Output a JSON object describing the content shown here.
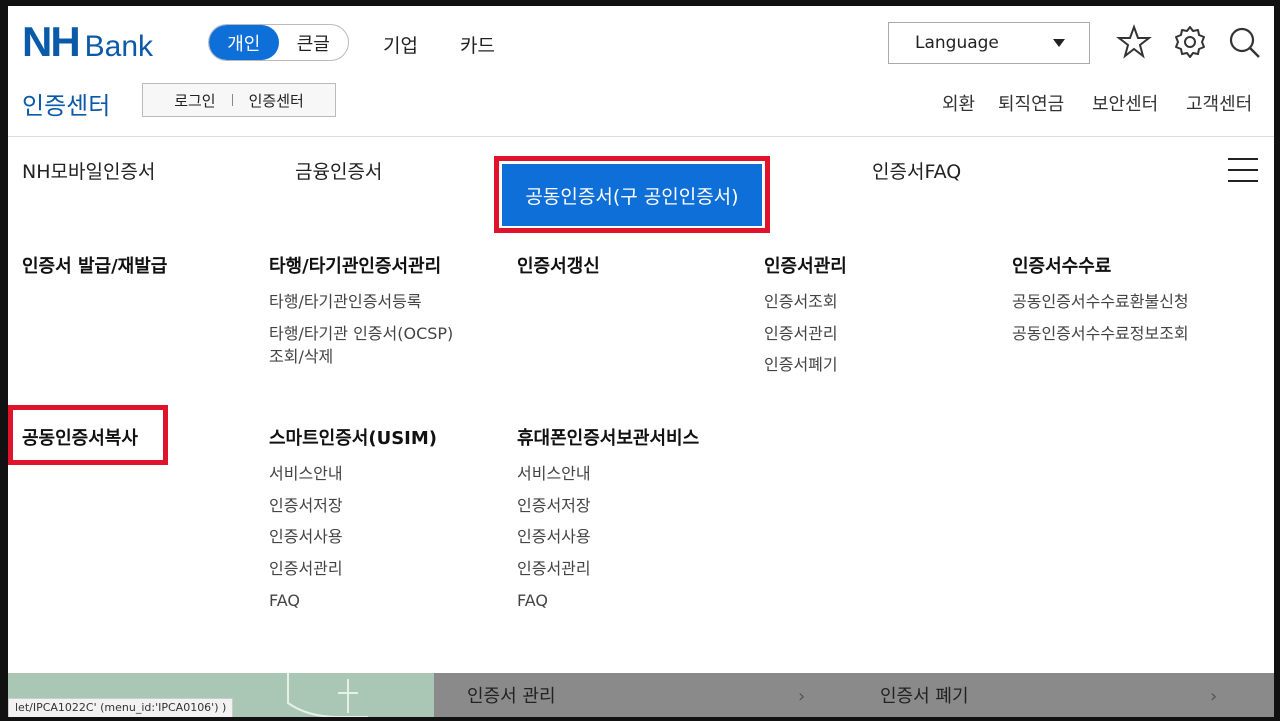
{
  "brand": {
    "nh": "NH",
    "bank": "Bank"
  },
  "segment": {
    "items": [
      "개인",
      "큰글"
    ],
    "active": 0
  },
  "top_nav": [
    "기업",
    "카드"
  ],
  "language": {
    "label": "Language"
  },
  "icons": [
    "star-icon",
    "gear-icon",
    "search-icon",
    "menu-icon"
  ],
  "section_title": "인증센터",
  "breadcrumb": {
    "login": "로그인",
    "center": "인증센터"
  },
  "util_links": [
    "외환",
    "퇴직연금",
    "보안센터",
    "고객센터"
  ],
  "gnb": {
    "items": [
      "NH모바일인증서",
      "금융인증서",
      "공동인증서(구 공인인증서)",
      "인증서FAQ"
    ],
    "active": 2
  },
  "menu": {
    "row1": [
      {
        "title": "인증서 발급/재발급",
        "items": []
      },
      {
        "title": "타행/타기관인증서관리",
        "items": [
          "타행/타기관인증서등록",
          "타행/타기관 인증서(OCSP)",
          "조회/삭제"
        ]
      },
      {
        "title": "인증서갱신",
        "items": []
      },
      {
        "title": "인증서관리",
        "items": [
          "인증서조회",
          "인증서관리",
          "인증서폐기"
        ]
      },
      {
        "title": "인증서수수료",
        "items": [
          "공동인증서수수료환불신청",
          "공동인증서수수료정보조회"
        ]
      }
    ],
    "row2": [
      {
        "title": "공동인증서복사",
        "items": []
      },
      {
        "title": "스마트인증서(USIM)",
        "items": [
          "서비스안내",
          "인증서저장",
          "인증서사용",
          "인증서관리",
          "FAQ"
        ]
      },
      {
        "title": "휴대폰인증서보관서비스",
        "items": [
          "서비스안내",
          "인증서저장",
          "인증서사용",
          "인증서관리",
          "FAQ"
        ]
      }
    ]
  },
  "bottom": {
    "item1": "인증서 관리",
    "item2": "인증서 폐기",
    "chevron": "›"
  },
  "status_url": "let/IPCA1022C' (menu_id:'IPCA0106') )",
  "colors": {
    "brand": "#0b5aa9",
    "accent": "#0f6fd8",
    "highlight": "#e0132d"
  }
}
